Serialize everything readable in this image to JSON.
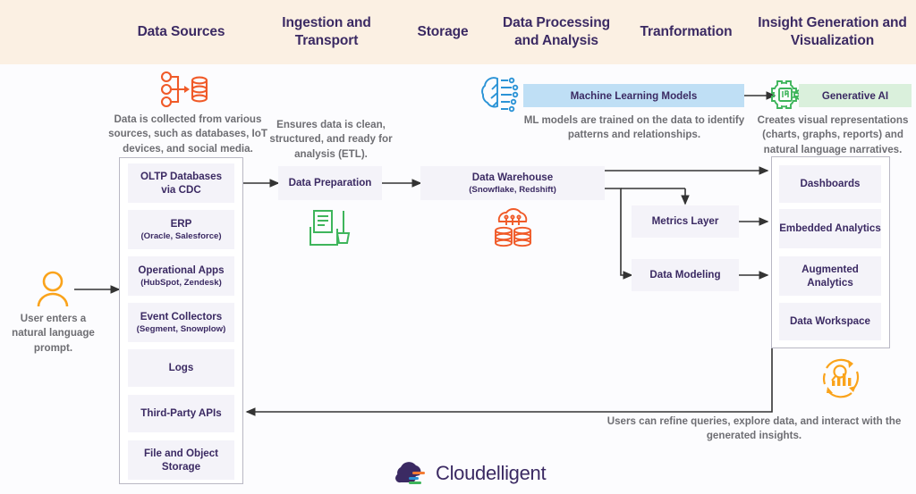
{
  "header": {
    "columns": [
      {
        "label": "Data Sources"
      },
      {
        "label": "Ingestion and Transport"
      },
      {
        "label": "Storage"
      },
      {
        "label": "Data Processing and Analysis"
      },
      {
        "label": "Tranformation"
      },
      {
        "label": "Insight Generation and Visualization"
      }
    ]
  },
  "captions": {
    "data_sources": "Data is collected from various sources, such as databases, IoT devices, and social media.",
    "ingestion": "Ensures data is clean, structured, and ready for analysis (ETL).",
    "ml": "ML models are trained on the data to identify patterns and relationships.",
    "genai": "Creates visual representations (charts, graphs, reports) and natural language narratives.",
    "user": "User enters a natural language prompt.",
    "feedback": "Users can refine queries, explore data, and interact with the generated insights."
  },
  "data_sources": {
    "items": [
      {
        "title": "OLTP Databases",
        "subtitle": "via CDC"
      },
      {
        "title": "ERP",
        "subtitle": "(Oracle, Salesforce)"
      },
      {
        "title": "Operational Apps",
        "subtitle": "(HubSpot, Zendesk)"
      },
      {
        "title": "Event Collectors",
        "subtitle": "(Segment, Snowplow)"
      },
      {
        "title": "Logs",
        "subtitle": ""
      },
      {
        "title": "Third-Party APIs",
        "subtitle": ""
      },
      {
        "title": "File and Object Storage",
        "subtitle": ""
      }
    ]
  },
  "ingestion": {
    "node": "Data Preparation"
  },
  "storage": {
    "title": "Data Warehouse",
    "subtitle": "(Snowflake, Redshift)"
  },
  "processing": {
    "banner": "Machine Learning Models"
  },
  "transformation": {
    "items": [
      {
        "title": "Metrics Layer"
      },
      {
        "title": "Data Modeling"
      }
    ]
  },
  "insight": {
    "banner": "Generative AI",
    "items": [
      {
        "title": "Dashboards"
      },
      {
        "title": "Embedded Analytics"
      },
      {
        "title": "Augmented Analytics"
      },
      {
        "title": "Data Workspace"
      }
    ]
  },
  "brand": {
    "name": "Cloudelligent"
  },
  "colors": {
    "header_bg": "#FBF0E3",
    "text_purple": "#3B2A63",
    "caption_gray": "#6E6E73",
    "node_fill": "#F4F3F9",
    "ml_banner": "#BFDFF5",
    "genai_banner": "#DAF0DC",
    "orange": "#F47B33",
    "green": "#3EB55B",
    "blue": "#2B93D6",
    "amber": "#FAA31B",
    "arrow": "#333333"
  }
}
